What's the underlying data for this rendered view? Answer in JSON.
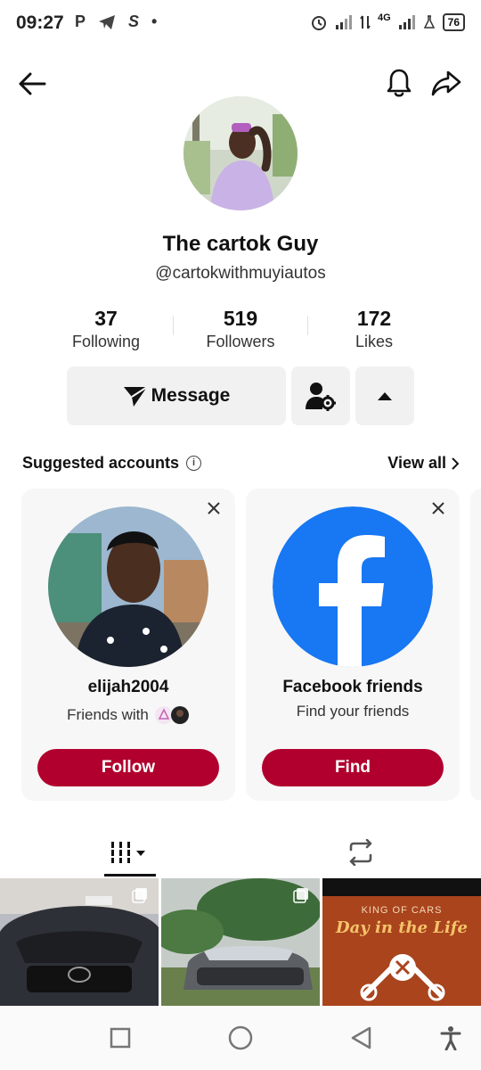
{
  "status_bar": {
    "time": "09:27",
    "left_icons": [
      "P",
      "telegram-icon",
      "S",
      "•"
    ],
    "network": "4G",
    "battery": "76"
  },
  "header": {
    "back_icon": "arrow-left-icon",
    "bell_icon": "bell-icon",
    "share_icon": "share-icon"
  },
  "profile": {
    "name": "The cartok Guy",
    "handle": "@cartokwithmuyiautos",
    "stats": [
      {
        "value": "37",
        "label": "Following"
      },
      {
        "value": "519",
        "label": "Followers"
      },
      {
        "value": "172",
        "label": "Likes"
      }
    ]
  },
  "actions": {
    "message_label": "Message"
  },
  "suggested": {
    "title": "Suggested accounts",
    "view_all": "View all",
    "cards": [
      {
        "name": "elijah2004",
        "subtitle": "Friends with",
        "button": "Follow"
      },
      {
        "name": "Facebook friends",
        "subtitle": "Find your friends",
        "button": "Find"
      }
    ]
  },
  "videos": [
    {
      "caption": ""
    },
    {
      "caption": ""
    },
    {
      "line1": "KING OF CARS",
      "line2": "Day in the Life"
    }
  ],
  "colors": {
    "accent": "#b1002d",
    "facebook": "#1877f2",
    "button_gray": "#f1f1f2"
  }
}
